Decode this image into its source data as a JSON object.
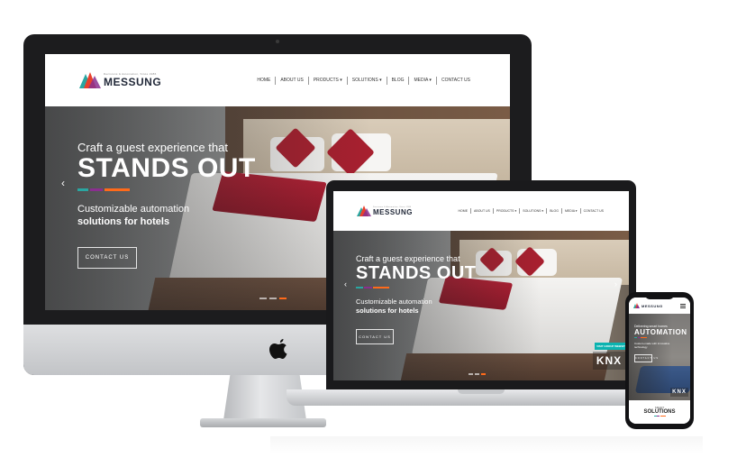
{
  "brand": {
    "name": "MESSUNG",
    "tagline": "Decisions & Automation, Since 1986",
    "colors": [
      "#2aa6a1",
      "#e8402c",
      "#8a2f8f",
      "#f5a11e"
    ]
  },
  "nav": {
    "items": [
      "HOME",
      "ABOUT US",
      "PRODUCTS ▾",
      "SOLUTIONS ▾",
      "BLOG",
      "MEDIA ▾",
      "CONTACT US"
    ]
  },
  "hero": {
    "kicker": "Craft a guest experience that",
    "title": "STANDS OUT",
    "sub1": "Customizable automation",
    "sub2": "solutions for hotels",
    "cta": "CONTACT US",
    "accent_colors": [
      "#2aa6a1",
      "#8a2f8f",
      "#ff6a1a"
    ],
    "active_dot_color": "#ff6a1a"
  },
  "laptop": {
    "knx_tag": "VISIT GROUP WEBSITE",
    "knx": "KNX"
  },
  "phone": {
    "kicker": "Delivering smart homes",
    "title": "AUTOMATION",
    "sub": "Custom-made with innovative technology",
    "cta": "CONTACT US",
    "section_kicker": "SMART",
    "section_title": "SOLUTIONS",
    "knx": "KNX"
  },
  "icons": {
    "arrow_left": "‹",
    "arrow_right": "›"
  }
}
